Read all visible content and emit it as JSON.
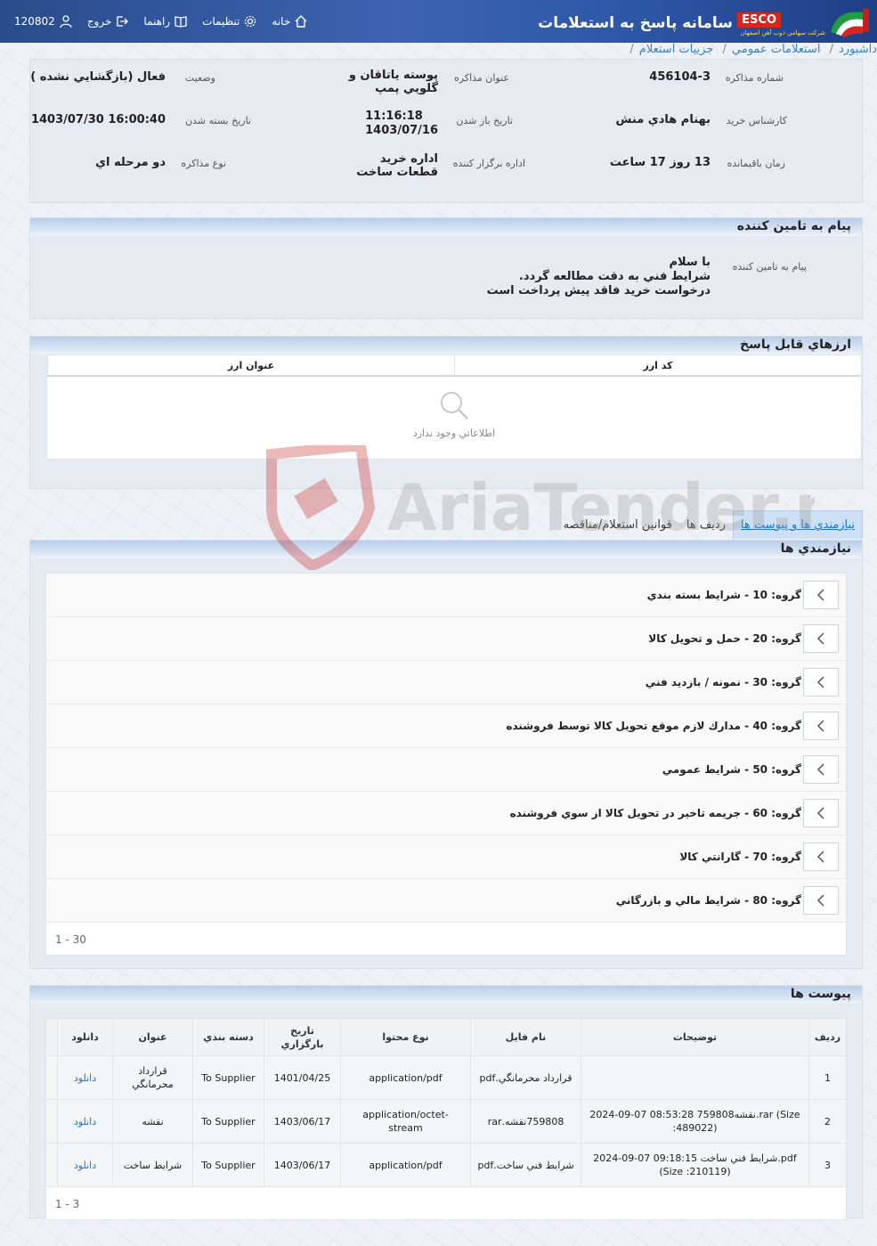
{
  "header": {
    "title": "سامانه پاسخ به استعلامات",
    "brand": "ESCO",
    "brand_sub": "شركت سهامي ذوب آهن اصفهان",
    "user_id": "120802",
    "menu": {
      "home": "خانه",
      "settings": "تنظيمات",
      "help": "راهنما",
      "logout": "خروج"
    }
  },
  "breadcrumb": [
    "داشبورد",
    "استعلامات عمومي",
    "جزييات استعلام"
  ],
  "info": {
    "number_label": "شماره مذاكره",
    "number": "456104-3",
    "title_label": "عنوان مذاكره",
    "title": "پوسته ياتاقان و گلويي پمپ",
    "status_label": "وضعيت",
    "status": "فعال (بازگشايي نشده )",
    "expert_label": "كارشناس خريد",
    "expert": "بهنام هادي منش",
    "open_label": "تاريخ باز شدن",
    "open_time": "11:16:18",
    "open_date": "1403/07/16",
    "close_label": "تاريخ بسته شدن",
    "close": "1403/07/30 16:00:40",
    "remaining_label": "زمان باقيمانده",
    "remaining": "13 روز 17 ساعت",
    "dept_label": "اداره برگزار كننده",
    "dept": "اداره خريد قطعات ساخت",
    "type_label": "نوع مذاكره",
    "type": "دو مرحله اي"
  },
  "message": {
    "title": "پيام به تامين كننده",
    "label": "پيام به تامين كننده",
    "lines": [
      "با سلام",
      "شرايط فني به دقت مطالعه گردد.",
      "درخواست خريد فاقد پيش پرداخت است"
    ]
  },
  "currencies": {
    "title": "ارزهاي قابل پاسخ",
    "col_code": "كد ارز",
    "col_title": "عنوان ارز",
    "empty": "اطلاعاتي وجود ندارد"
  },
  "tabs": [
    "نيازمندي ها و پيوست ها",
    "رديف ها",
    "قوانين استعلام/مناقصه"
  ],
  "requirements": {
    "title": "نيازمندي ها",
    "groups": [
      "گروه: 10 - شرايط بسته بندي",
      "گروه: 20 - حمل و تحويل كالا",
      "گروه: 30 - نمونه / بازديد فني",
      "گروه: 40 - مدارك لازم موقع تحويل كالا توسط فروشنده",
      "گروه: 50 - شرايط عمومي",
      "گروه: 60 - جريمه تاخير در تحويل كالا از سوي فروشنده",
      "گروه: 70 - گارانتي كالا",
      "گروه: 80 - شرايط مالي و بازرگاني"
    ],
    "pager": "1 - 30"
  },
  "attachments": {
    "title": "پيوست ها",
    "columns": [
      "رديف",
      "توضيحات",
      "نام فايل",
      "نوع محتوا",
      "تاريخ بارگزاري",
      "دسته بندي",
      "عنوان",
      "دانلود"
    ],
    "rows": [
      [
        "1",
        "",
        "قرارداد محرمانگي.pdf",
        "application/pdf",
        "1401/04/25",
        "To Supplier",
        "قرارداد محرمانگي",
        "دانلود"
      ],
      [
        "2",
        "2024-09-07 08:53:28 759808نقشه.rar (Size :489022)",
        "759808نقشه.rar",
        "application/octet-stream",
        "1403/06/17",
        "To Supplier",
        "نقشه",
        "دانلود"
      ],
      [
        "3",
        "2024-09-07 09:18:15 شرايط فني ساخت.pdf (Size :210119)",
        "شرايط فني ساخت.pdf",
        "application/pdf",
        "1403/06/17",
        "To Supplier",
        "شرايط ساخت",
        "دانلود"
      ]
    ],
    "pager": "1 - 3"
  },
  "watermark": "AriaTender.neT"
}
